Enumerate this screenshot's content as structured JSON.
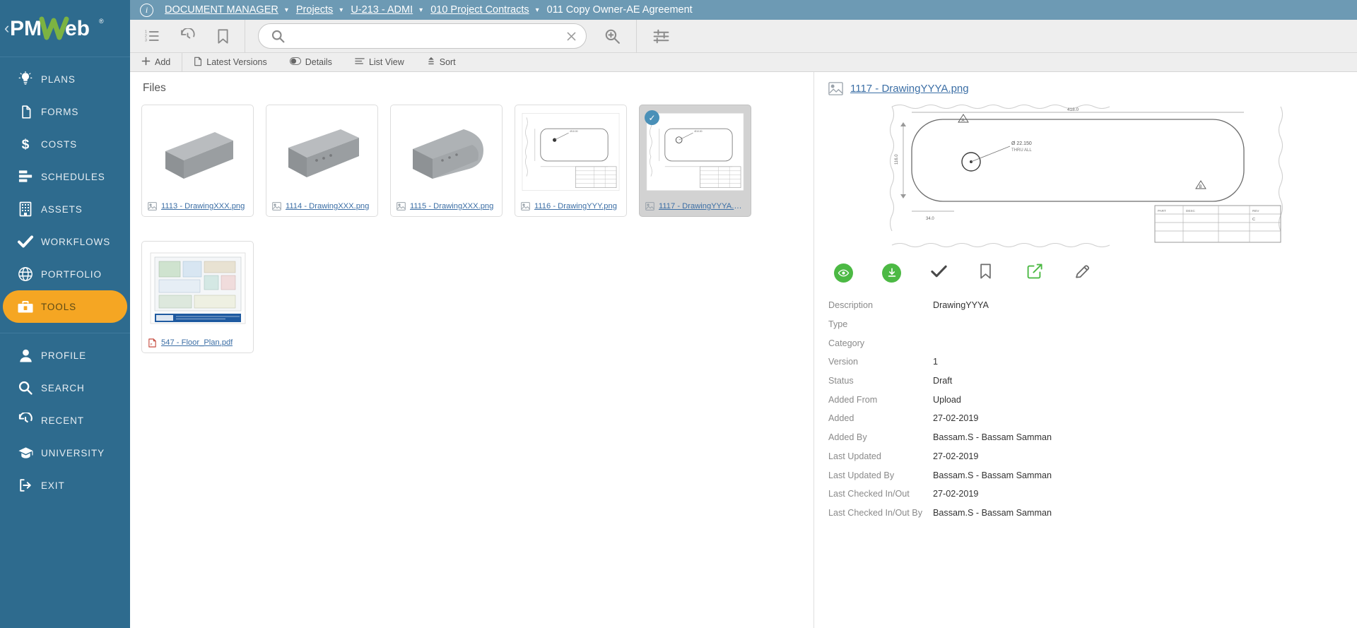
{
  "brand": {
    "name": "PMWeb",
    "registered": "®",
    "collapse_chevron": "‹"
  },
  "topbar": {
    "info_icon": "info-icon",
    "breadcrumbs": [
      {
        "label": "DOCUMENT MANAGER",
        "has_caret": true
      },
      {
        "label": "Projects",
        "has_caret": true
      },
      {
        "label": "U-213 - ADMI",
        "has_caret": true
      },
      {
        "label": "010 Project Contracts",
        "has_caret": true
      },
      {
        "label": "011 Copy Owner-AE Agreement",
        "has_caret": false
      }
    ],
    "caret": "▾"
  },
  "toolbar": {
    "icons": [
      {
        "name": "numbered-list-icon"
      },
      {
        "name": "history-icon"
      },
      {
        "name": "bookmark-icon"
      }
    ],
    "search": {
      "value": "",
      "placeholder": ""
    },
    "search_icon": "search-icon",
    "clear_icon": "close-icon",
    "zoom_search_icon": "zoom-search-icon",
    "filter_icon": "filter-sliders-icon"
  },
  "actionbar": {
    "items": [
      {
        "label": "Add",
        "icon": "plus-icon"
      },
      {
        "label": "Latest Versions",
        "icon": "document-icon"
      },
      {
        "label": "Details",
        "icon": "toggle-icon"
      },
      {
        "label": "List View",
        "icon": "list-view-icon"
      },
      {
        "label": "Sort",
        "icon": "sort-icon"
      }
    ]
  },
  "sidebar": {
    "items": [
      {
        "label": "PLANS",
        "icon": "lightbulb-icon",
        "active": false
      },
      {
        "label": "FORMS",
        "icon": "document-icon",
        "active": false
      },
      {
        "label": "COSTS",
        "icon": "dollar-icon",
        "active": false
      },
      {
        "label": "SCHEDULES",
        "icon": "bars-icon",
        "active": false
      },
      {
        "label": "ASSETS",
        "icon": "building-icon",
        "active": false
      },
      {
        "label": "WORKFLOWS",
        "icon": "checkmark-icon",
        "active": false
      },
      {
        "label": "PORTFOLIO",
        "icon": "globe-icon",
        "active": false
      },
      {
        "label": "TOOLS",
        "icon": "toolbox-icon",
        "active": true
      }
    ],
    "bottom_items": [
      {
        "label": "PROFILE",
        "icon": "person-icon"
      },
      {
        "label": "SEARCH",
        "icon": "search-icon"
      },
      {
        "label": "RECENT",
        "icon": "history-icon"
      },
      {
        "label": "UNIVERSITY",
        "icon": "graduation-cap-icon"
      },
      {
        "label": "EXIT",
        "icon": "exit-icon"
      }
    ],
    "accent_color": "#f5a623",
    "background_color": "#2e6b8e"
  },
  "files": {
    "title": "Files",
    "items": [
      {
        "name": "1113 - DrawingXXX.png",
        "type": "image",
        "thumb": "block-flat",
        "selected": false
      },
      {
        "name": "1114 - DrawingXXX.png",
        "type": "image",
        "thumb": "block-holes",
        "selected": false
      },
      {
        "name": "1115 - DrawingXXX.png",
        "type": "image",
        "thumb": "block-round",
        "selected": false
      },
      {
        "name": "1116 - DrawingYYY.png",
        "type": "image",
        "thumb": "drawing",
        "selected": false
      },
      {
        "name": "1117 - DrawingYYYA.png",
        "type": "image",
        "thumb": "drawing",
        "selected": true
      },
      {
        "name": "547 - Floor_Plan.pdf",
        "type": "pdf",
        "thumb": "floorplan",
        "selected": false
      }
    ],
    "selected_check": "✓"
  },
  "details": {
    "title": "1117 - DrawingYYYA.png",
    "title_icon": "image-icon",
    "actions": [
      {
        "name": "view-action",
        "icon": "eye-icon",
        "style": "green-circle"
      },
      {
        "name": "download-action",
        "icon": "download-icon",
        "style": "green-circle"
      },
      {
        "name": "approve-action",
        "icon": "checkmark-icon",
        "style": "plain"
      },
      {
        "name": "bookmark-action",
        "icon": "bookmark-icon",
        "style": "plain"
      },
      {
        "name": "edit-action",
        "icon": "edit-square-icon",
        "style": "green-outline"
      },
      {
        "name": "markup-action",
        "icon": "pen-icon",
        "style": "plain"
      }
    ],
    "fields": [
      {
        "label": "Description",
        "value": "DrawingYYYA"
      },
      {
        "label": "Type",
        "value": ""
      },
      {
        "label": "Category",
        "value": ""
      },
      {
        "label": "Version",
        "value": "1"
      },
      {
        "label": "Status",
        "value": "Draft"
      },
      {
        "label": "Added From",
        "value": "Upload"
      },
      {
        "label": "Added",
        "value": "27-02-2019"
      },
      {
        "label": "Added By",
        "value": "Bassam.S - Bassam Samman"
      },
      {
        "label": "Last Updated",
        "value": "27-02-2019"
      },
      {
        "label": "Last Updated By",
        "value": "Bassam.S - Bassam Samman"
      },
      {
        "label": "Last Checked In/Out",
        "value": "27-02-2019"
      },
      {
        "label": "Last Checked In/Out By",
        "value": "Bassam.S - Bassam Samman"
      }
    ]
  }
}
